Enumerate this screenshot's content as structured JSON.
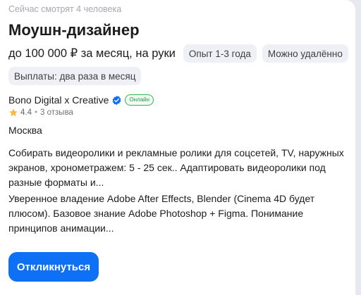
{
  "vacancy": {
    "viewers": "Сейчас смотрят 4 человека",
    "title": "Моушн-дизайнер",
    "salary": "до 100 000 ₽ за месяц, на руки",
    "experience": "Опыт 1-3 года",
    "remote": "Можно удалённо",
    "payout": "Выплаты: два раза в месяц",
    "company": {
      "name": "Bono Digital x Creative",
      "online_label": "Онлайн",
      "rating": "4.4",
      "reviews": "3 отзыва"
    },
    "city": "Москва",
    "description": "Собирать видеоролики и рекламные ролики для соцсетей, TV, наружных экранов, хронометражем: 5 - 25 сек.. Адаптировать видеоролики под разные форматы и...",
    "requirements": "Уверенное владение Adobe After Effects, Blender (Cinema 4D будет плюсом). Базовое знание Adobe Photoshop + Figma. Понимание принципов анимации...",
    "respond_label": "Откликнуться"
  },
  "icons": {
    "verified": "verified-check-icon",
    "star": "star-icon"
  },
  "colors": {
    "accent": "#0d70f5",
    "online": "#2fb54f",
    "star": "#f5b84a",
    "chip_bg": "#eef0f5"
  }
}
